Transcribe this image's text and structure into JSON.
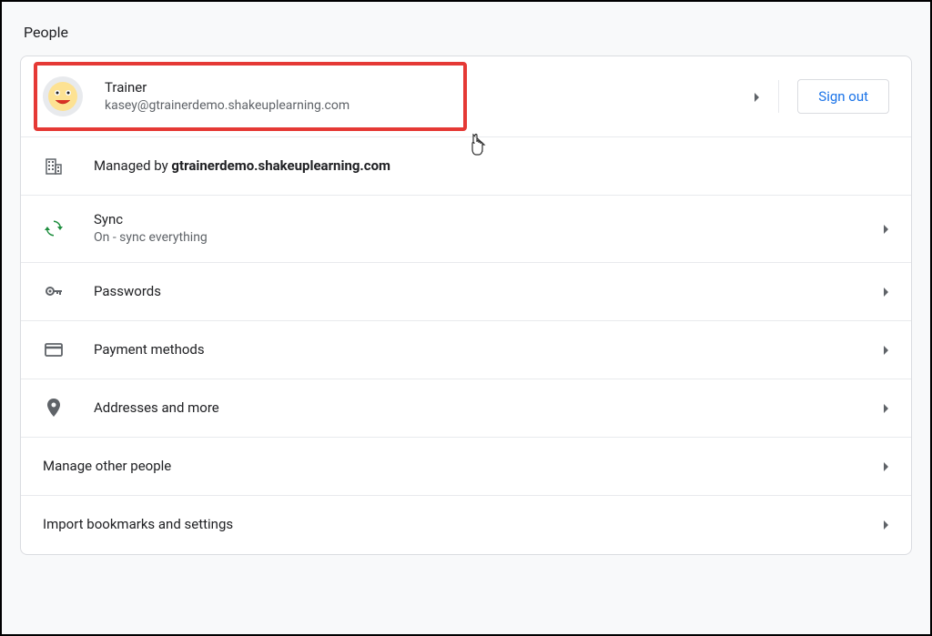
{
  "section": {
    "title": "People"
  },
  "profile": {
    "name": "Trainer",
    "email": "kasey@gtrainerdemo.shakeuplearning.com",
    "sign_out_label": "Sign out"
  },
  "managed": {
    "prefix": "Managed by ",
    "domain": "gtrainerdemo.shakeuplearning.com"
  },
  "sync": {
    "title": "Sync",
    "status": "On - sync everything"
  },
  "passwords": {
    "title": "Passwords"
  },
  "payment": {
    "title": "Payment methods"
  },
  "addresses": {
    "title": "Addresses and more"
  },
  "manage_people": {
    "title": "Manage other people"
  },
  "import": {
    "title": "Import bookmarks and settings"
  }
}
